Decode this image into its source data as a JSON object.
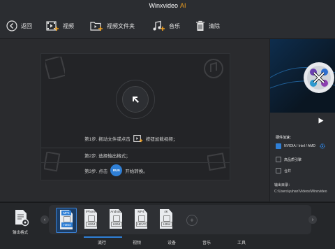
{
  "app": {
    "title": "Winxvideo",
    "title_suffix": "AI"
  },
  "toolbar": {
    "back": "返回",
    "video": "视频",
    "folder": "视频文件夹",
    "music": "音乐",
    "clear": "清除"
  },
  "drop_area": {
    "step1_a": "第1步. 拖动文件或点击",
    "step1_b": "按钮加载视频；",
    "step2": "第2步. 选择输出格式；",
    "step3_a": "第3步. 点击",
    "step3_b": "开始转换。",
    "run_label": "RUN"
  },
  "options": {
    "hw_accel_label": "硬件加速：",
    "hw_accel_value": "NVIDIA / Intel / AMD",
    "high_quality": "高品质引擎",
    "merge": "合并",
    "output_dir_label": "输出目录：",
    "output_dir_value": "C:\\Users\\yuhan\\Videos\\Winxvideo"
  },
  "bottom": {
    "output_format_label": "输出格式",
    "formats": [
      {
        "top": "MP4",
        "codec": "H264",
        "selected": true
      },
      {
        "top": "iPhone",
        "codec": "H264",
        "selected": false
      },
      {
        "top": "Android",
        "codec": "H264",
        "selected": false
      },
      {
        "top": "MP4",
        "codec": "HEVC",
        "selected": false
      },
      {
        "top": "4K",
        "codec": "H264",
        "selected": false
      }
    ],
    "tabs": [
      "流行",
      "视频",
      "设备",
      "音乐",
      "工具"
    ]
  },
  "colors": {
    "accent": "#2f7fd6",
    "title_accent": "#f0a020"
  }
}
